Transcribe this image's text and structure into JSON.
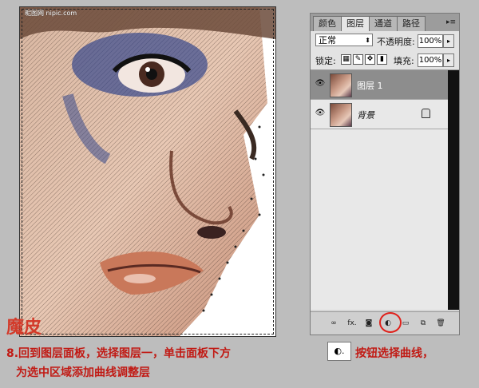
{
  "canvas": {
    "watermark": "昵图网 nipic.com"
  },
  "panel": {
    "tabs": [
      "颜色",
      "图层",
      "通道",
      "路径"
    ],
    "menu_icon": "panel-menu-icon",
    "blend_mode": "正常",
    "opacity_label": "不透明度:",
    "opacity_value": "100%",
    "lock_label": "锁定:",
    "fill_label": "填充:",
    "fill_value": "100%",
    "layers": [
      {
        "name": "图层 1",
        "selected": true
      },
      {
        "name": "背景",
        "selected": false,
        "locked": true
      }
    ],
    "footer_buttons": [
      "link-icon",
      "fx",
      "mask-icon",
      "adjustment-layer-icon",
      "group-icon",
      "new-layer-icon",
      "trash-icon"
    ],
    "footer_fx": "fx."
  },
  "captions": {
    "title": "魔皮",
    "line1_a": "8.回到图层面板，选择图层一，单击面板下方",
    "line1_b": "按钮选择曲线，",
    "line2": "为选中区域添加曲线调整层"
  },
  "colors": {
    "accent_red": "#c11a14",
    "selected_layer": "#8d8d8d"
  }
}
